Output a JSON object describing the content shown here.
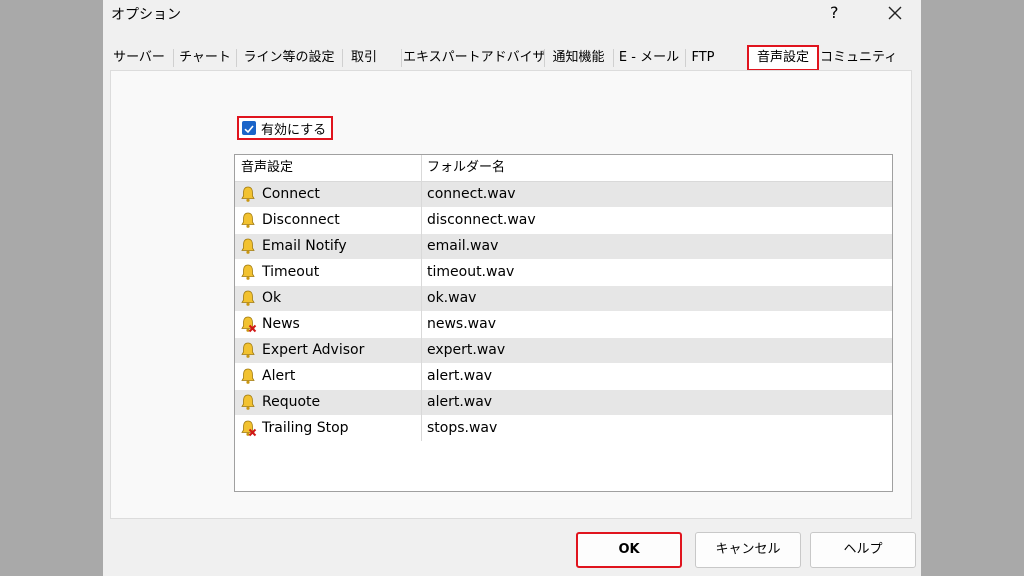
{
  "window": {
    "title": "オプション",
    "help_label": "?"
  },
  "tabs": [
    {
      "label": "サーバー"
    },
    {
      "label": "チャート"
    },
    {
      "label": "ライン等の設定"
    },
    {
      "label": "取引"
    },
    {
      "label": "エキスパートアドバイザ"
    },
    {
      "label": "通知機能"
    },
    {
      "label": "E - メール"
    },
    {
      "label": "FTP"
    },
    {
      "label": "音声設定",
      "active": true
    },
    {
      "label": "コミュニティ"
    }
  ],
  "enable": {
    "label": "有効にする",
    "checked": true
  },
  "table": {
    "headers": [
      "音声設定",
      "フォルダー名"
    ],
    "rows": [
      {
        "event": "Connect",
        "file": "connect.wav",
        "icon": "bell-icon"
      },
      {
        "event": "Disconnect",
        "file": "disconnect.wav",
        "icon": "bell-icon"
      },
      {
        "event": "Email Notify",
        "file": "email.wav",
        "icon": "bell-icon"
      },
      {
        "event": "Timeout",
        "file": "timeout.wav",
        "icon": "bell-icon"
      },
      {
        "event": "Ok",
        "file": "ok.wav",
        "icon": "bell-icon"
      },
      {
        "event": "News",
        "file": "news.wav",
        "icon": "bell-disabled-icon"
      },
      {
        "event": "Expert Advisor",
        "file": "expert.wav",
        "icon": "bell-icon"
      },
      {
        "event": "Alert",
        "file": "alert.wav",
        "icon": "bell-icon"
      },
      {
        "event": "Requote",
        "file": "alert.wav",
        "icon": "bell-icon"
      },
      {
        "event": "Trailing Stop",
        "file": "stops.wav",
        "icon": "bell-disabled-icon"
      }
    ]
  },
  "buttons": {
    "ok": "OK",
    "cancel": "キャンセル",
    "help": "ヘルプ"
  },
  "colors": {
    "highlight": "#e0141e",
    "checkbox": "#1a64c8",
    "bell": "#f2c230"
  }
}
